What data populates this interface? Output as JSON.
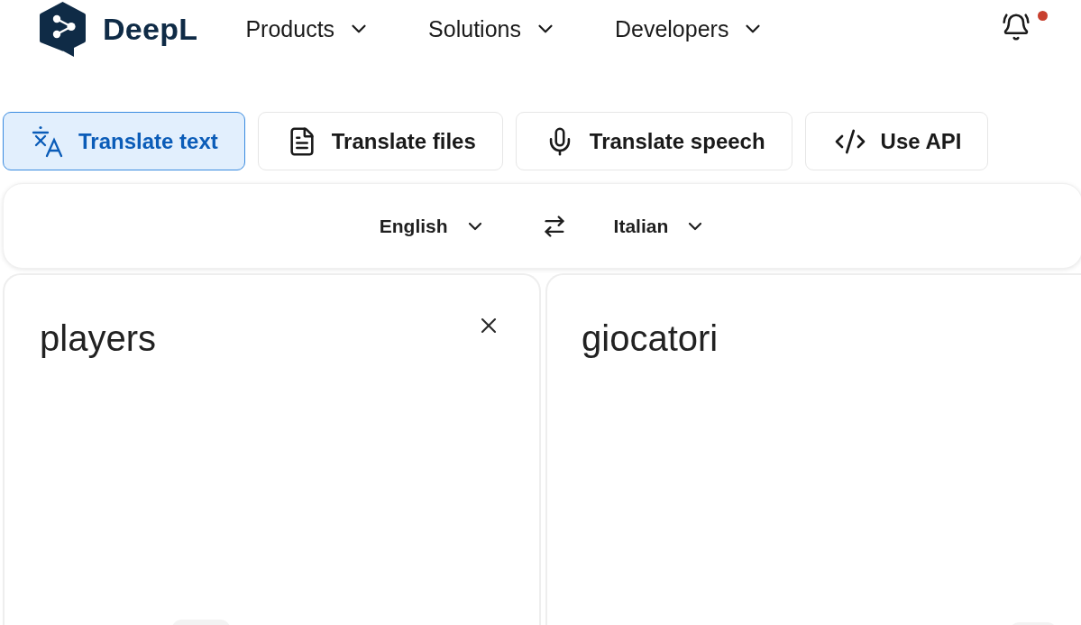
{
  "header": {
    "brand": "DeepL",
    "nav": [
      {
        "label": "Products"
      },
      {
        "label": "Solutions"
      },
      {
        "label": "Developers"
      }
    ],
    "notifications": {
      "unread": true
    }
  },
  "tabs": [
    {
      "label": "Translate text",
      "kind": "text",
      "selected": true
    },
    {
      "label": "Translate files",
      "kind": "files",
      "selected": false
    },
    {
      "label": "Translate speech",
      "kind": "speech",
      "selected": false
    },
    {
      "label": "Use API",
      "kind": "api",
      "selected": false
    }
  ],
  "languages": {
    "source": "English",
    "target": "Italian"
  },
  "source": {
    "value": "players"
  },
  "target": {
    "translation": "giocatori"
  }
}
